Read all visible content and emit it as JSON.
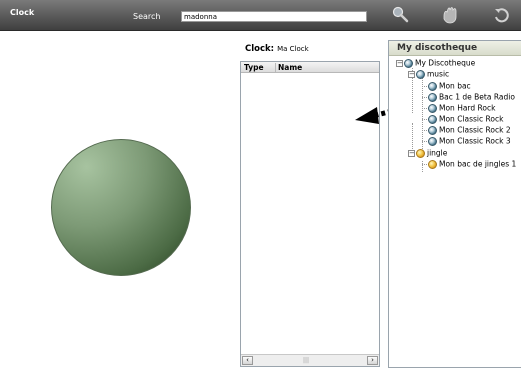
{
  "toolbar": {
    "app_title": "Clock",
    "search_label": "Search",
    "search_value": "madonna",
    "icons": [
      "search-icon",
      "hand-icon",
      "refresh-icon"
    ]
  },
  "clock": {
    "label": "Clock:",
    "name": "Ma Clock"
  },
  "item_list": {
    "columns": [
      "Type",
      "Name"
    ],
    "rows": []
  },
  "discotheque": {
    "title": "My discotheque",
    "root": "My Discotheque",
    "music": {
      "label": "music",
      "items": [
        "Mon bac",
        "Bac 1 de Beta Radio",
        "Mon Hard Rock",
        "Mon Classic Rock",
        "Mon Classic Rock 2",
        "Mon Classic Rock 3"
      ]
    },
    "jingle": {
      "label": "jingle",
      "items": [
        "Mon bac de jingles 1"
      ]
    }
  },
  "colors": {
    "toolbar": "#5c5c5c",
    "clock_disc": "#4c6b45",
    "music_icon": "#4c7a90",
    "jingle_icon": "#f3c84b"
  }
}
